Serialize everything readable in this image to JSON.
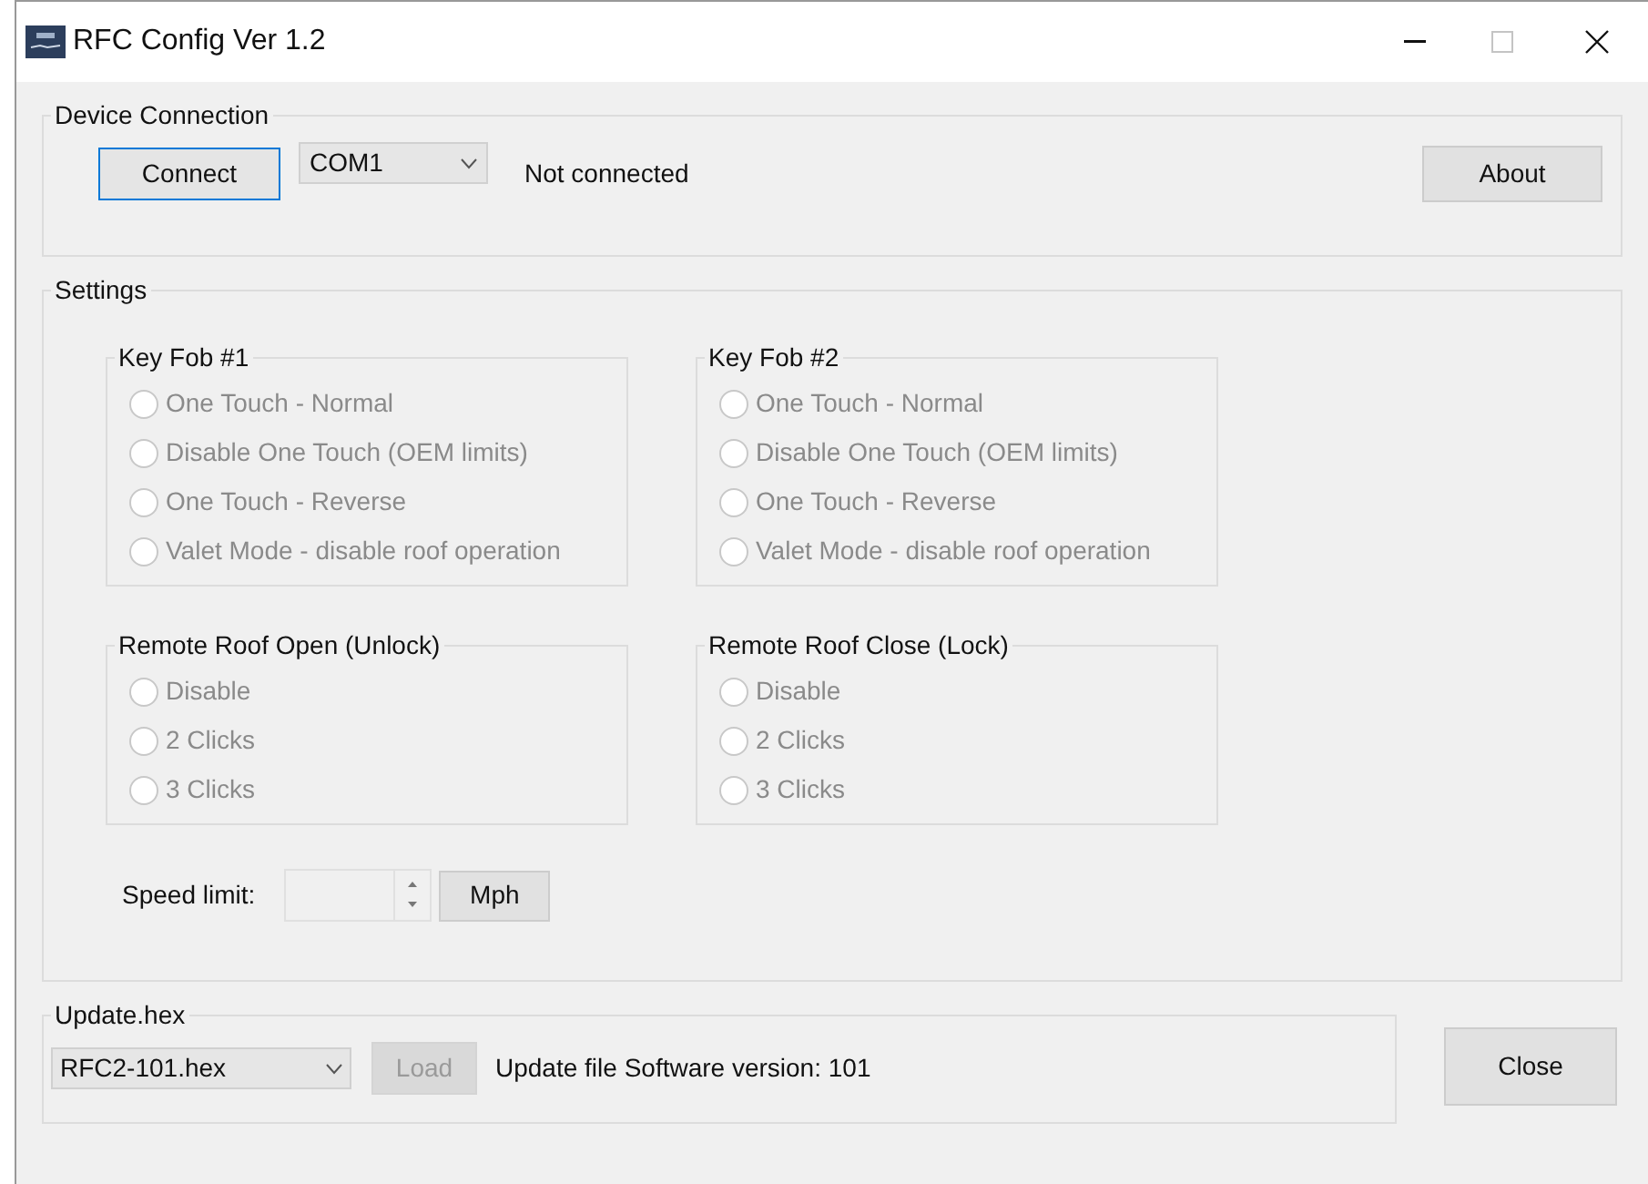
{
  "window": {
    "title": "RFC Config Ver 1.2",
    "maximize_disabled": true
  },
  "device_connection": {
    "title": "Device Connection",
    "connect_button": "Connect",
    "port": {
      "value": "COM1"
    },
    "status": "Not connected",
    "about_button": "About"
  },
  "settings": {
    "title": "Settings",
    "groups": [
      {
        "title": "Key Fob #1",
        "options": [
          {
            "label": "One Touch - Normal",
            "selected": false,
            "disabled": true
          },
          {
            "label": "Disable One Touch (OEM limits)",
            "selected": false,
            "disabled": true
          },
          {
            "label": "One Touch - Reverse",
            "selected": false,
            "disabled": true
          },
          {
            "label": "Valet Mode - disable roof operation",
            "selected": false,
            "disabled": true
          }
        ]
      },
      {
        "title": "Key Fob #2",
        "options": [
          {
            "label": "One Touch - Normal",
            "selected": false,
            "disabled": true
          },
          {
            "label": "Disable One Touch (OEM limits)",
            "selected": false,
            "disabled": true
          },
          {
            "label": "One Touch - Reverse",
            "selected": false,
            "disabled": true
          },
          {
            "label": "Valet Mode - disable roof operation",
            "selected": false,
            "disabled": true
          }
        ]
      },
      {
        "title": "Remote Roof Open (Unlock)",
        "options": [
          {
            "label": "Disable",
            "selected": false,
            "disabled": true
          },
          {
            "label": "2 Clicks",
            "selected": false,
            "disabled": true
          },
          {
            "label": "3 Clicks",
            "selected": false,
            "disabled": true
          }
        ]
      },
      {
        "title": "Remote Roof Close (Lock)",
        "options": [
          {
            "label": "Disable",
            "selected": false,
            "disabled": true
          },
          {
            "label": "2 Clicks",
            "selected": false,
            "disabled": true
          },
          {
            "label": "3 Clicks",
            "selected": false,
            "disabled": true
          }
        ]
      }
    ],
    "speed_limit": {
      "label": "Speed limit:",
      "disabled": true,
      "unit_button": "Mph"
    }
  },
  "update": {
    "title": "Update.hex",
    "file": {
      "value": "RFC2-101.hex"
    },
    "load_button": {
      "label": "Load",
      "disabled": true
    },
    "info": "Update file Software version: 101"
  },
  "close_button": "Close"
}
